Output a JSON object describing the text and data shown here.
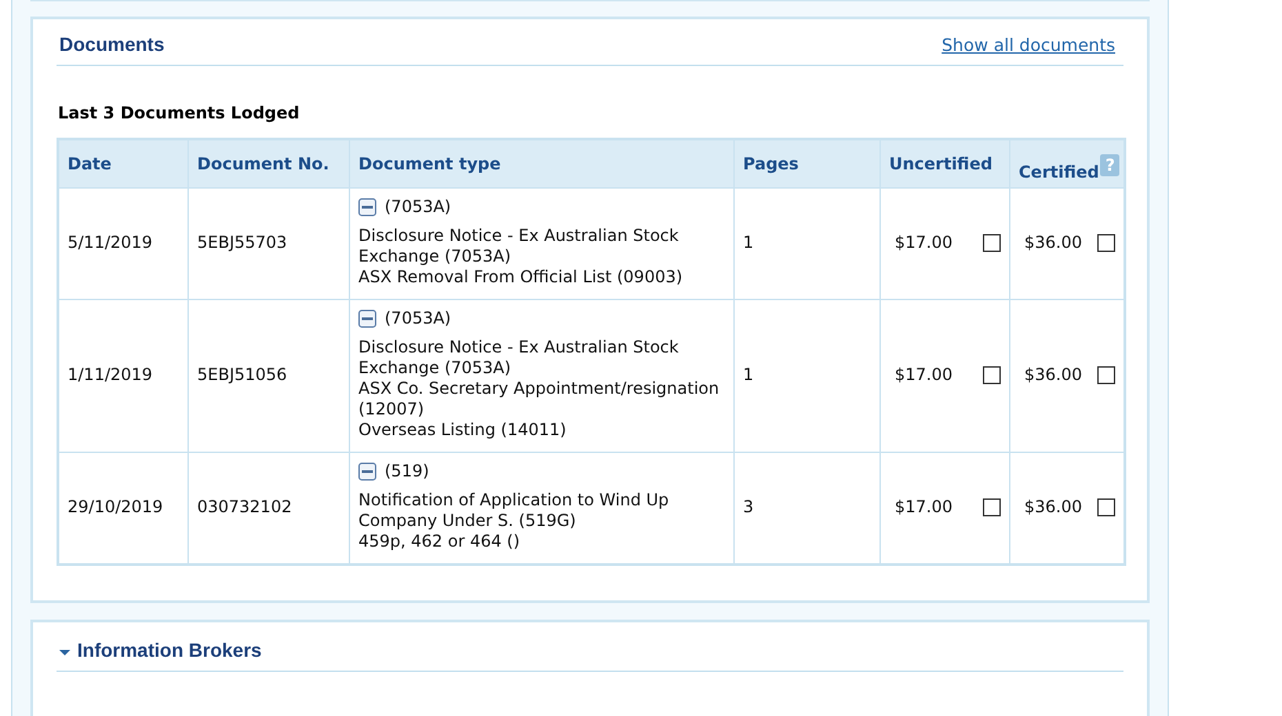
{
  "documents": {
    "title": "Documents",
    "show_all_link": "Show all documents",
    "subtitle": "Last 3 Documents Lodged",
    "table": {
      "columns": [
        "Date",
        "Document No.",
        "Document type",
        "Pages",
        "Uncertified",
        "Certified"
      ],
      "help_icon": "?",
      "rows": [
        {
          "date": "5/11/2019",
          "document_no": "5EBJ55703",
          "type_code": "(7053A)",
          "expanded": true,
          "descriptions": [
            "Disclosure Notice - Ex Australian Stock Exchange (7053A)",
            "ASX Removal From Official List (09003)"
          ],
          "pages": "1",
          "uncertified": "$17.00",
          "uncertified_checked": false,
          "certified": "$36.00",
          "certified_checked": false
        },
        {
          "date": "1/11/2019",
          "document_no": "5EBJ51056",
          "type_code": "(7053A)",
          "expanded": true,
          "descriptions": [
            "Disclosure Notice - Ex Australian Stock Exchange (7053A)",
            "ASX Co. Secretary Appointment/resignation (12007)",
            "Overseas Listing (14011)"
          ],
          "pages": "1",
          "uncertified": "$17.00",
          "uncertified_checked": false,
          "certified": "$36.00",
          "certified_checked": false
        },
        {
          "date": "29/10/2019",
          "document_no": "030732102",
          "type_code": "(519)",
          "expanded": true,
          "descriptions": [
            "Notification of Application to Wind Up Company Under S. (519G)",
            "459p, 462 or 464 ()"
          ],
          "pages": "3",
          "uncertified": "$17.00",
          "uncertified_checked": false,
          "certified": "$36.00",
          "certified_checked": false
        }
      ]
    }
  },
  "information_brokers": {
    "title": "Information Brokers",
    "expanded": true
  }
}
